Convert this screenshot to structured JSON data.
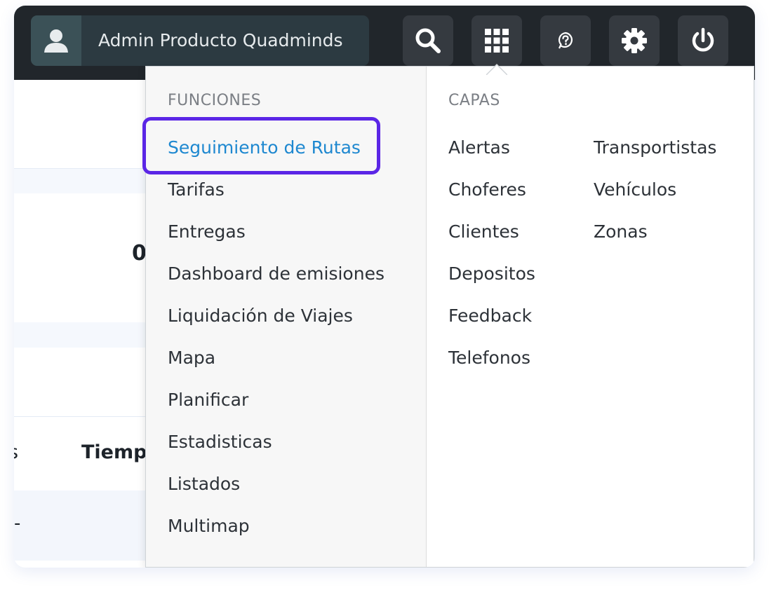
{
  "header": {
    "user_name": "Admin Producto Quadminds",
    "icons": [
      "user-icon",
      "search-icon",
      "apps-grid-icon",
      "help-icon",
      "gear-icon",
      "power-icon"
    ]
  },
  "background": {
    "value": "0",
    "column_header": "Tiempo",
    "partial_left_text": "s",
    "partial_left_row": "-"
  },
  "menu": {
    "funciones": {
      "title": "FUNCIONES",
      "items": [
        "Seguimiento de Rutas",
        "Tarifas",
        "Entregas",
        "Dashboard de emisiones",
        "Liquidación de Viajes",
        "Mapa",
        "Planificar",
        "Estadisticas",
        "Listados",
        "Multimap"
      ],
      "active_index": 0
    },
    "capas": {
      "title": "CAPAS",
      "col1": [
        "Alertas",
        "Choferes",
        "Clientes",
        "Depositos",
        "Feedback",
        "Telefonos"
      ],
      "col2": [
        "Transportistas",
        "Vehículos",
        "Zonas"
      ]
    }
  },
  "colors": {
    "topbar": "#21262b",
    "active_link": "#1e88d0",
    "highlight": "#5b26e6"
  }
}
